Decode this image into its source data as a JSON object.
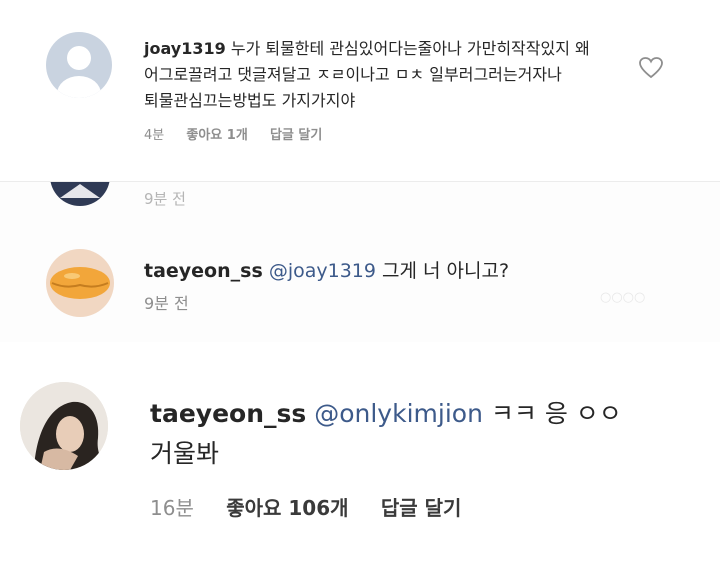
{
  "comment1": {
    "username": "joay1319",
    "lines": [
      "누가 퇴물한테 관심있어다는줄아나 가만히작작있지 왜",
      "어그로끌려고 댓글져달고 ㅈㄹ이나고 ㅁㅊ 일부러그러는거자나",
      "퇴물관심끄는방법도 가지가지야"
    ],
    "time": "4분",
    "likes": "좋아요 1개",
    "reply": "답글 달기",
    "like_icon": "heart-outline-icon"
  },
  "partial": {
    "time": "9분 전"
  },
  "comment2": {
    "username": "taeyeon_ss",
    "mention": "@joay1319",
    "text": "그게 너 아니고?",
    "time": "9분 전"
  },
  "comment3": {
    "username": "taeyeon_ss",
    "mention": "@onlykimjion",
    "text_line1": "ㅋㅋ 응 ㅇㅇ",
    "text_line2": "거울봐",
    "time": "16분",
    "likes": "좋아요 106개",
    "reply": "답글 달기"
  },
  "colors": {
    "mention": "#3d5a8a",
    "meta": "#8e8e8e",
    "username": "#262626"
  }
}
